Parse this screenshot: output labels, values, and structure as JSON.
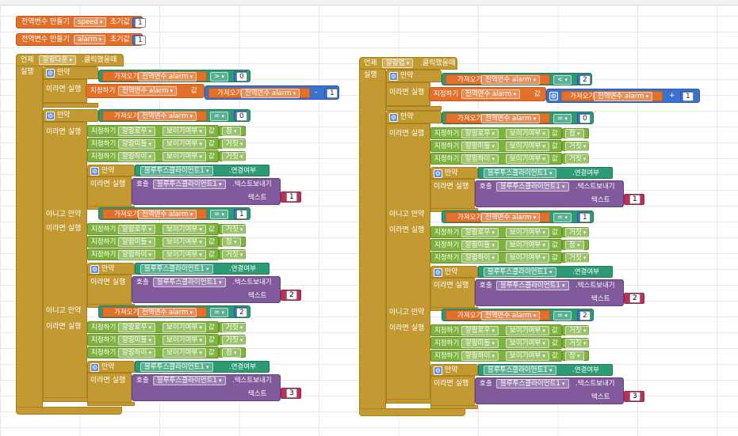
{
  "globals": [
    {
      "prefix": "전역변수 만들기",
      "name": "speed",
      "suffix": "초기값",
      "value": "1"
    },
    {
      "prefix": "전역변수 만들기",
      "name": "alarm",
      "suffix": "초기값",
      "value": "1"
    }
  ],
  "labels": {
    "when": "언제",
    "clicked": ".클릭했을때",
    "do": "실행",
    "if": "만약",
    "then": "이라면 실행",
    "elseif": "아니고 만약",
    "get": "가져오기",
    "set": "지정하기",
    "to": "값",
    "visible": "보이기여부",
    "call": "호출",
    "send_text": ".텍스트보내기",
    "text": "텍스트",
    "global_alarm": "전역변수 alarm",
    "bt_client": "블루투스클라이언트1",
    "is_connected": ".연결여부"
  },
  "block_left": {
    "button": "알람다운",
    "cond1": {
      "op": ">",
      "value": "0"
    },
    "math_op": "-",
    "math_value": "1",
    "branches": [
      {
        "op": "=",
        "value": "0",
        "items": [
          [
            "알람로우",
            "참"
          ],
          [
            "알람미들",
            "거짓"
          ],
          [
            "알람하이",
            "거짓"
          ]
        ],
        "send": "1"
      },
      {
        "op": "=",
        "value": "1",
        "items": [
          [
            "알람로우",
            "거짓"
          ],
          [
            "알람미들",
            "참"
          ],
          [
            "알람하이",
            "거짓"
          ]
        ],
        "send": "2"
      },
      {
        "op": "=",
        "value": "2",
        "items": [
          [
            "알람로우",
            "거짓"
          ],
          [
            "알람미들",
            "거짓"
          ],
          [
            "알람하이",
            "참"
          ]
        ],
        "send": "3"
      }
    ]
  },
  "block_right": {
    "button": "알람업",
    "cond1": {
      "op": "<",
      "value": "2"
    },
    "math_op": "+",
    "math_value": "1",
    "branches": [
      {
        "op": "=",
        "value": "0",
        "items": [
          [
            "알람로우",
            "참"
          ],
          [
            "알람미들",
            "거짓"
          ],
          [
            "알람하이",
            "거짓"
          ]
        ],
        "send": "1"
      },
      {
        "op": "=",
        "value": "1",
        "items": [
          [
            "알람로우",
            "거짓"
          ],
          [
            "알람미들",
            "참"
          ],
          [
            "알람하이",
            "거짓"
          ]
        ],
        "send": "2"
      },
      {
        "op": "=",
        "value": "2",
        "items": [
          [
            "알람로우",
            "거짓"
          ],
          [
            "알람미들",
            "거짓"
          ],
          [
            "알람하이",
            "참"
          ]
        ],
        "send": "3"
      }
    ]
  }
}
